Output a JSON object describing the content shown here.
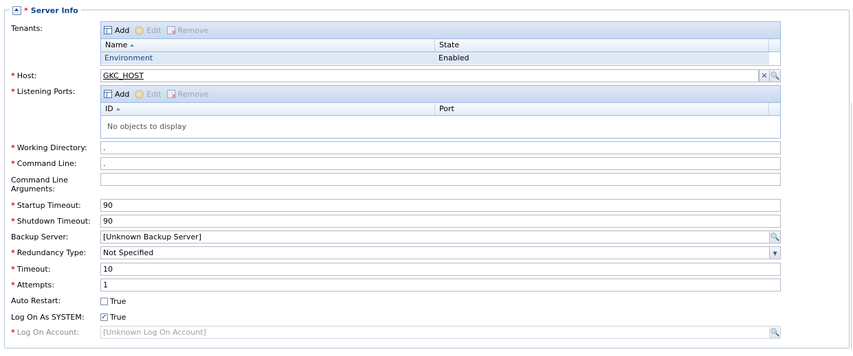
{
  "section": {
    "required_mark": "*",
    "title": "Server Info"
  },
  "labels": {
    "tenants": "Tenants:",
    "host": "Host:",
    "listening_ports": "Listening Ports:",
    "working_directory": "Working Directory:",
    "command_line": "Command Line:",
    "command_line_arguments_1": "Command Line",
    "command_line_arguments_2": "Arguments:",
    "startup_timeout": "Startup Timeout:",
    "shutdown_timeout": "Shutdown Timeout:",
    "backup_server": "Backup Server:",
    "redundancy_type": "Redundancy Type:",
    "timeout": "Timeout:",
    "attempts": "Attempts:",
    "auto_restart": "Auto Restart:",
    "log_on_as_system": "Log On As SYSTEM:",
    "log_on_account": "Log On Account:"
  },
  "required_mark": "*",
  "toolbar": {
    "add": "Add",
    "edit": "Edit",
    "remove": "Remove"
  },
  "tenants_grid": {
    "columns": [
      "Name",
      "State"
    ],
    "rows": [
      {
        "name": "Environment",
        "state": "Enabled"
      }
    ]
  },
  "ports_grid": {
    "columns": [
      "ID",
      "Port"
    ],
    "empty_text": "No objects to display"
  },
  "values": {
    "host": "GKC_HOST",
    "working_directory": ".",
    "command_line": ".",
    "command_line_arguments": "",
    "startup_timeout": "90",
    "shutdown_timeout": "90",
    "backup_server": "[Unknown Backup Server]",
    "redundancy_type": "Not Specified",
    "timeout": "10",
    "attempts": "1",
    "auto_restart": {
      "checked": false,
      "label": "True"
    },
    "log_on_as_system": {
      "checked": true,
      "label": "True"
    },
    "log_on_account": "[Unknown Log On Account]"
  },
  "glyphs": {
    "clear": "✕",
    "search": "🔍",
    "dropdown": "▾",
    "check": "✓"
  },
  "colors": {
    "accent": "#15428b",
    "required": "#e01818",
    "grid_border": "#99bbe8",
    "link": "#15428b"
  }
}
